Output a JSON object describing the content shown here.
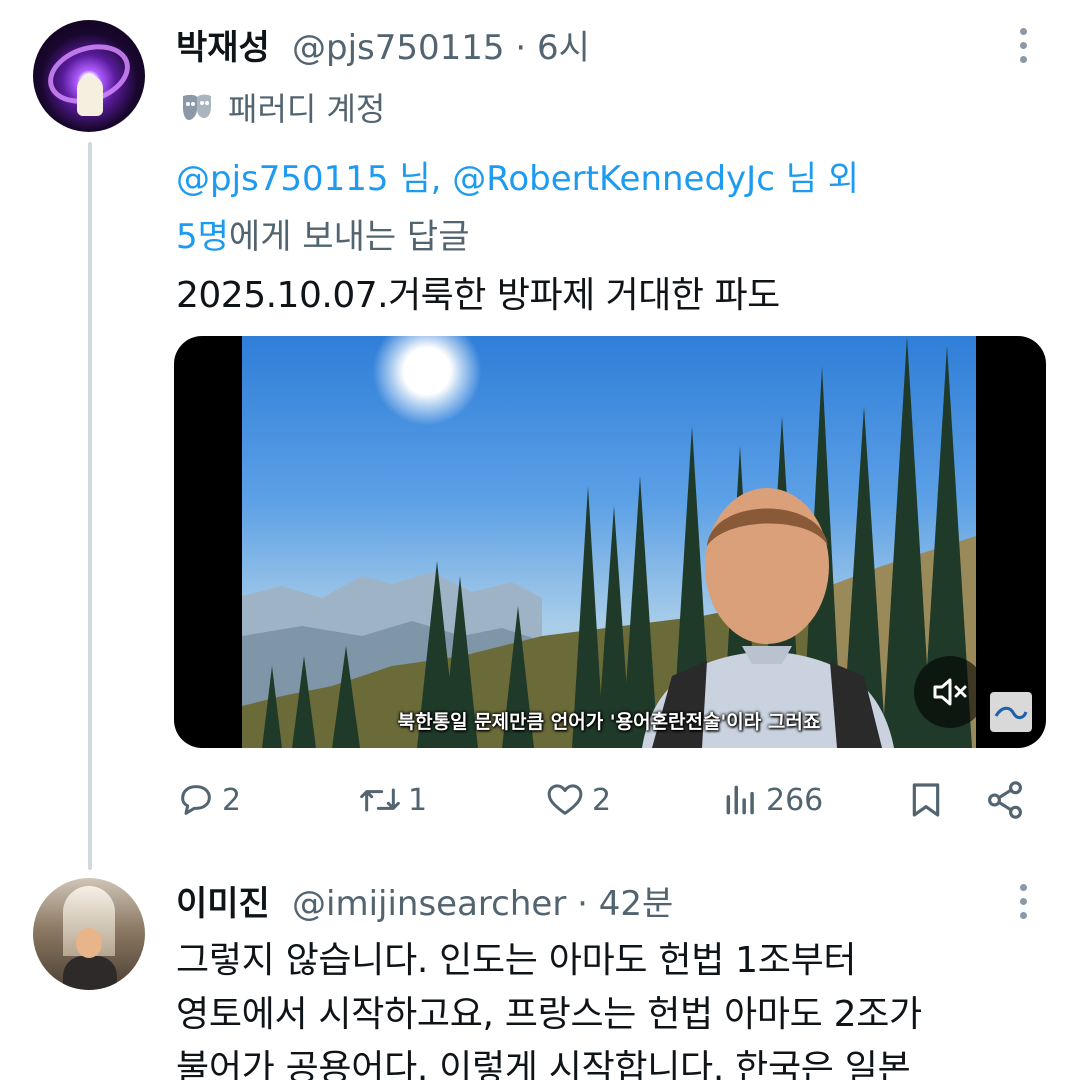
{
  "post1": {
    "display_name": "박재성",
    "handle_time": "@pjs750115 · 6시",
    "parody_label": "패러디 계정",
    "reply_to": {
      "mention1": "@pjs750115 님, @RobertKennedyJc 님 외",
      "mention2": "5명",
      "suffix": "에게 보내는 답글"
    },
    "text": "2025.10.07.거룩한 방파제 거대한 파도",
    "media": {
      "subtitle": "북한통일 문제만큼 언어가 '용어혼란전술'이라 그러죠"
    },
    "actions": {
      "replies": "2",
      "reposts": "1",
      "likes": "2",
      "views": "266"
    }
  },
  "post2": {
    "display_name": "이미진",
    "handle_time": "@imijinsearcher · 42분",
    "text_lines": [
      "그렇지 않습니다. 인도는 아마도 헌법 1조부터",
      "영토에서 시작하고요, 프랑스는 헌법 아마도 2조가",
      "불어가 공용어다. 이렇게 시작합니다. 한국은 일본"
    ]
  },
  "colors": {
    "accent": "#1d9bf0",
    "secondary_text": "#536471",
    "primary_text": "#0f1419",
    "thread_line": "#cfd9de"
  }
}
